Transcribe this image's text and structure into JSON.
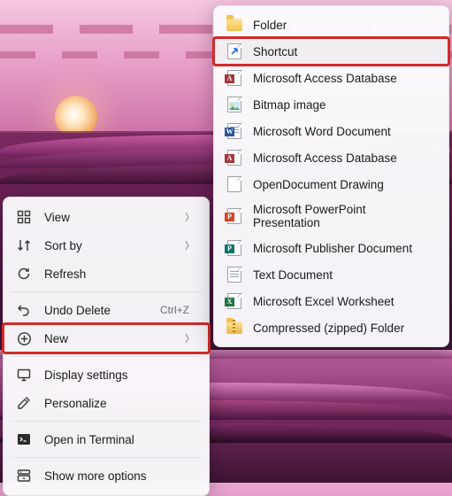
{
  "context_menu": {
    "items": [
      {
        "label": "View",
        "has_submenu": true
      },
      {
        "label": "Sort by",
        "has_submenu": true
      },
      {
        "label": "Refresh"
      },
      {
        "label": "Undo Delete",
        "shortcut": "Ctrl+Z"
      },
      {
        "label": "New",
        "has_submenu": true,
        "highlighted": true
      },
      {
        "label": "Display settings"
      },
      {
        "label": "Personalize"
      },
      {
        "label": "Open in Terminal"
      },
      {
        "label": "Show more options"
      }
    ]
  },
  "new_submenu": {
    "items": [
      {
        "label": "Folder"
      },
      {
        "label": "Shortcut",
        "highlighted": true,
        "hovered": true
      },
      {
        "label": "Microsoft Access Database"
      },
      {
        "label": "Bitmap image"
      },
      {
        "label": "Microsoft Word Document"
      },
      {
        "label": "Microsoft Access Database"
      },
      {
        "label": "OpenDocument Drawing"
      },
      {
        "label": "Microsoft PowerPoint Presentation"
      },
      {
        "label": "Microsoft Publisher Document"
      },
      {
        "label": "Text Document"
      },
      {
        "label": "Microsoft Excel Worksheet"
      },
      {
        "label": "Compressed (zipped) Folder"
      }
    ]
  }
}
